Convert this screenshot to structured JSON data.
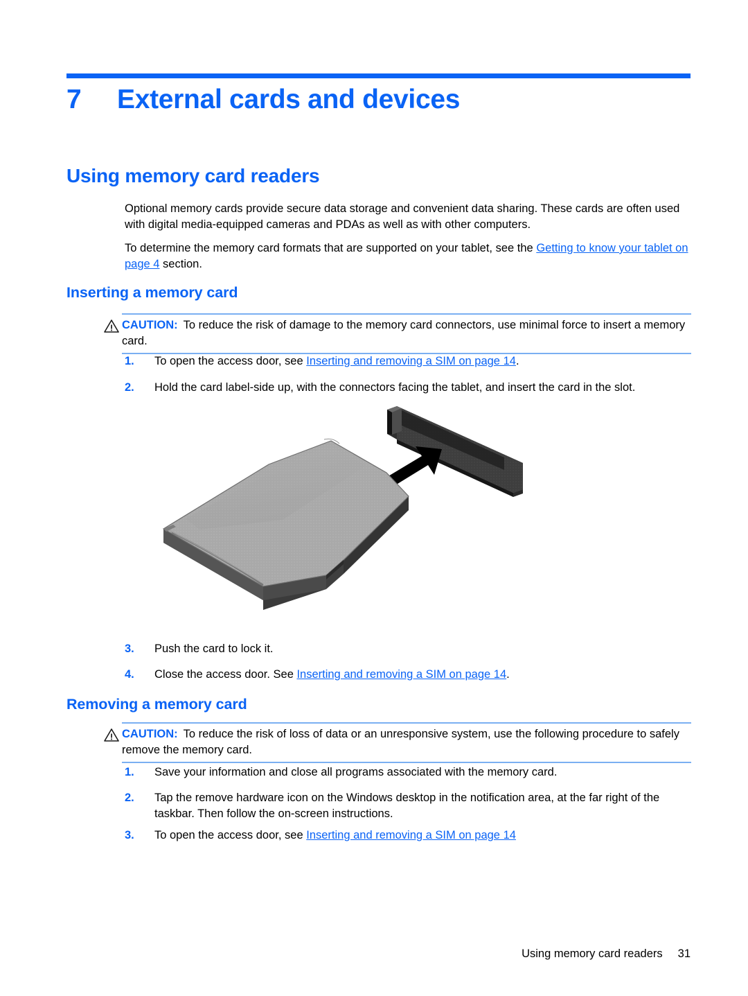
{
  "colors": {
    "accent_blue": "#0a63f5",
    "caution_rule": "#7aaff2",
    "text": "#000000",
    "card_gray": "#a8a8a8",
    "slot_dark": "#3a3a3a"
  },
  "chapter": {
    "number": "7",
    "title": "External cards and devices"
  },
  "sections": {
    "using": {
      "heading": "Using memory card readers",
      "paragraph_1": "Optional memory cards provide secure data storage and convenient data sharing. These cards are often used with digital media-equipped cameras and PDAs as well as with other computers.",
      "paragraph_2_before": "To determine the memory card formats that are supported on your tablet, see the ",
      "paragraph_2_link": "Getting to know your tablet on page 4",
      "paragraph_2_after": " section."
    },
    "inserting": {
      "heading": "Inserting a memory card",
      "caution": {
        "icon": "warning-triangle-icon",
        "label": "CAUTION:",
        "text": "To reduce the risk of damage to the memory card connectors, use minimal force to insert a memory card."
      },
      "steps": [
        {
          "number": "1.",
          "text_before": "To open the access door, see ",
          "link": "Inserting and removing a SIM on page 14",
          "text_after": "."
        },
        {
          "number": "2.",
          "text_before": "Hold the card label-side up, with the connectors facing the tablet, and insert the card in the slot.",
          "link": "",
          "text_after": ""
        },
        {
          "number": "3.",
          "text_before": "Push the card to lock it.",
          "link": "",
          "text_after": ""
        },
        {
          "number": "4.",
          "text_before": "Close the access door. See ",
          "link": "Inserting and removing a SIM on page 14",
          "text_after": "."
        }
      ],
      "figure": {
        "name": "memory-card-insertion-illustration",
        "description": "Isometric drawing of a gray SD memory card below a dark memory card slot with a black arrow pointing up and to the right toward the slot."
      }
    },
    "removing": {
      "heading": "Removing a memory card",
      "caution": {
        "icon": "warning-triangle-icon",
        "label": "CAUTION:",
        "text": "To reduce the risk of loss of data or an unresponsive system, use the following procedure to safely remove the memory card."
      },
      "steps": [
        {
          "number": "1.",
          "text_before": "Save your information and close all programs associated with the memory card.",
          "link": "",
          "text_after": ""
        },
        {
          "number": "2.",
          "text_before": "Tap the remove hardware icon on the Windows desktop in the notification area, at the far right of the taskbar. Then follow the on-screen instructions.",
          "link": "",
          "text_after": ""
        },
        {
          "number": "3.",
          "text_before": "To open the access door, see ",
          "link": "Inserting and removing a SIM on page 14",
          "text_after": ""
        }
      ]
    }
  },
  "footer": {
    "running_head": "Using memory card readers",
    "page_number": "31"
  }
}
